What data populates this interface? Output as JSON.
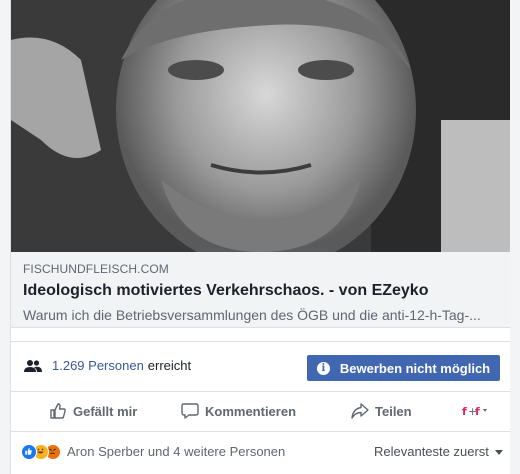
{
  "link_preview": {
    "domain": "FISCHUNDFLEISCH.COM",
    "title": "Ideologisch motiviertes Verkehrschaos. - von EZeyko",
    "description": "Warum ich die Betriebsversammlungen des ÖGB und die anti-12-h-Tag-..."
  },
  "reach": {
    "icon": "people-icon",
    "count": "1.269 Personen",
    "suffix": "erreicht"
  },
  "boost": {
    "icon": "info-icon",
    "label": "Bewerben nicht möglich"
  },
  "actions": {
    "like": "Gefällt mir",
    "comment": "Kommentieren",
    "share": "Teilen"
  },
  "reactions": {
    "icons": [
      "like-reaction-icon",
      "haha-reaction-icon",
      "angry-reaction-icon"
    ],
    "summary": "Aron Sperber und 4 weitere Personen"
  },
  "comments_sort": {
    "selected": "Relevanteste zuerst"
  },
  "colors": {
    "accent": "#4267b2",
    "link": "#385898",
    "muted_text": "#606770"
  }
}
